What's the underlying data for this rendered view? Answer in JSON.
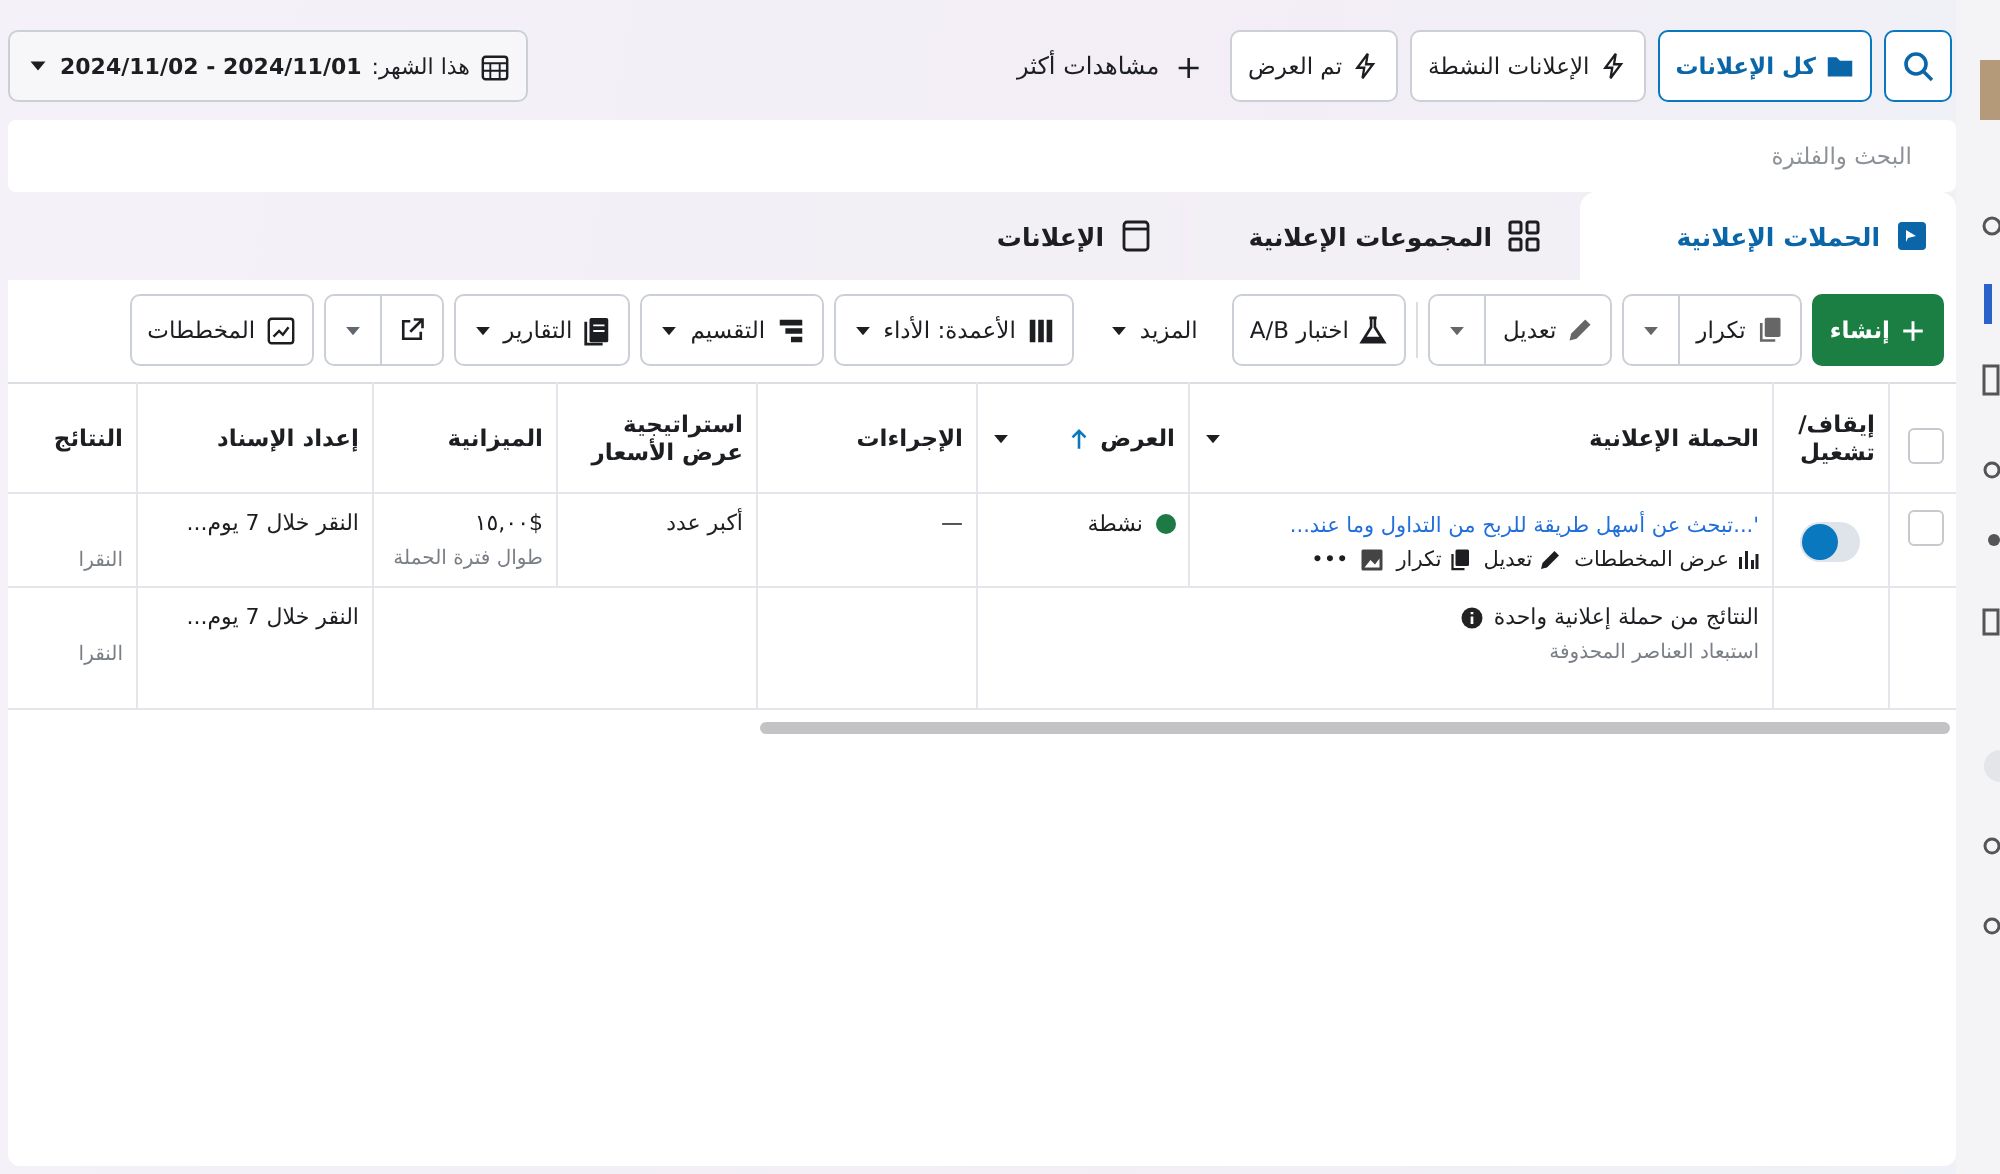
{
  "views": [
    {
      "label": "كل الإعلانات",
      "selected": true
    },
    {
      "label": "الإعلانات النشطة",
      "selected": false
    },
    {
      "label": "تم العرض",
      "selected": false
    }
  ],
  "more_views": {
    "icon": "+",
    "label": "مشاهدات أكثر"
  },
  "date_range": {
    "preset": "هذا الشهر:",
    "range": "2024/11/01 - 2024/11/02"
  },
  "search": {
    "placeholder": "البحث والفلترة"
  },
  "tabs": [
    {
      "label": "الحملات الإعلانية",
      "selected": true
    },
    {
      "label": "المجموعات الإعلانية",
      "selected": false
    },
    {
      "label": "الإعلانات",
      "selected": false
    }
  ],
  "toolbar": [
    {
      "kind": "primary",
      "label": "إنشاء",
      "disabled": false
    },
    {
      "kind": "split",
      "label": "تكرار",
      "disabled": true
    },
    {
      "kind": "split",
      "label": "تعديل",
      "disabled": true
    },
    {
      "kind": "plain",
      "label": "اختبار A/B",
      "disabled": false
    },
    {
      "kind": "menu",
      "label": "المزيد",
      "disabled": false
    },
    {
      "kind": "dropdown",
      "label": "الأعمدة: الأداء",
      "disabled": false
    },
    {
      "kind": "dropdown",
      "label": "التقسيم",
      "disabled": false
    },
    {
      "kind": "dropdown",
      "label": "التقارير",
      "disabled": false
    },
    {
      "kind": "iconsplit",
      "disabled": false
    },
    {
      "kind": "plain",
      "label": "المخططات",
      "disabled": false
    }
  ],
  "table": {
    "select_all": {
      "checked": false
    },
    "columns": [
      {
        "label": "إيقاف/ تشغيل",
        "menu": false,
        "sorted": false
      },
      {
        "label": "الحملة الإعلانية",
        "menu": true,
        "sorted": false
      },
      {
        "label": "العرض",
        "menu": true,
        "sorted": true
      },
      {
        "label": "الإجراءات",
        "menu": false,
        "sorted": false
      },
      {
        "label": "استراتيجية عرض الأسعار",
        "menu": false,
        "sorted": false
      },
      {
        "label": "الميزانية",
        "menu": false,
        "sorted": false
      },
      {
        "label": "إعداد الإسناد",
        "menu": false,
        "sorted": false
      },
      {
        "label": "النتائج",
        "menu": false,
        "sorted": false
      }
    ],
    "rows": [
      {
        "kind": "campaign",
        "selected": false,
        "on": true,
        "name": "'...تبحث عن أسهل طريقة للربح من التداول وما عند...",
        "links": [
          {
            "label": "عرض المخططات"
          },
          {
            "label": "تعديل"
          },
          {
            "label": "تكرار"
          },
          {
            "label": "•••"
          }
        ],
        "status": {
          "label": "نشطة",
          "color": "#1e7a45"
        },
        "actions": "—",
        "bid_strategy": "أكبر عدد",
        "budget": "$١٥,٠٠",
        "budget_note": "طوال فترة الحملة",
        "attribution": "النقر خلال 7 يوم...",
        "results_note": "النقرا"
      },
      {
        "kind": "summary",
        "title": "النتائج من حملة إعلانية واحدة",
        "note": "استبعاد العناصر المحذوفة",
        "attribution": "النقر خلال 7 يوم...",
        "results_note": "النقرا"
      }
    ]
  }
}
